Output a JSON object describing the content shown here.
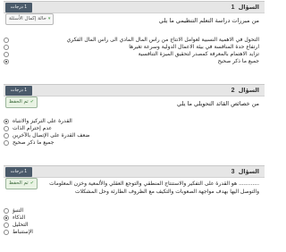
{
  "q1": {
    "title_label": "السؤال",
    "number": "1",
    "points": "1 درجات",
    "tag": "حالة إكمال الأسئلة",
    "prompt": "من مبررات دراسة التعلم التنظيمي ما يلي",
    "options": [
      {
        "label": "التحول في الاهمية النسبية لعوامل الانتاج من راس المال المادي الى راس المال الفكري",
        "selected": false
      },
      {
        "label": "ارتفاع حدة المنافسة في بيئة الاعمال الدولية وسرعة تغيرها",
        "selected": false
      },
      {
        "label": "تزايد الاهتمام بالمعرفة كمصدر لتحقيق الميزة التنافسية",
        "selected": false
      },
      {
        "label": "جميع ما ذكر صحيح",
        "selected": true
      }
    ]
  },
  "q2": {
    "title_label": "السؤال",
    "number": "2",
    "points": "1 درجات",
    "tag": "تم الحفظ",
    "prompt": "من خصائص القائد التحويلي ما يلي",
    "options": [
      {
        "label": "القدرة على التركيز والانتباه",
        "selected": true
      },
      {
        "label": "عدم إحترام الذات",
        "selected": false
      },
      {
        "label": "ضعف القدرة على الإتصال بالآخرين",
        "selected": false
      },
      {
        "label": "جميع ما ذكر صحيح",
        "selected": false
      }
    ]
  },
  "q3": {
    "title_label": "السؤال",
    "number": "3",
    "points": "1 درجات",
    "tag": "تم الحفظ",
    "prompt_line1": "............ هو القدرة على التفكير والاستنتاج المنطقي والتوجع العقلي والألمعية وخزن المعلومات",
    "prompt_line2": "والتوصل اليها بهدف مواجهة الصعوبات والتكيف مع الظروف الطارئة وحل المشكلات",
    "options": [
      {
        "label": "التنبؤ",
        "selected": false
      },
      {
        "label": "الذكاء",
        "selected": true
      },
      {
        "label": "التحليل",
        "selected": false
      },
      {
        "label": "الإستنباط",
        "selected": false
      }
    ]
  }
}
